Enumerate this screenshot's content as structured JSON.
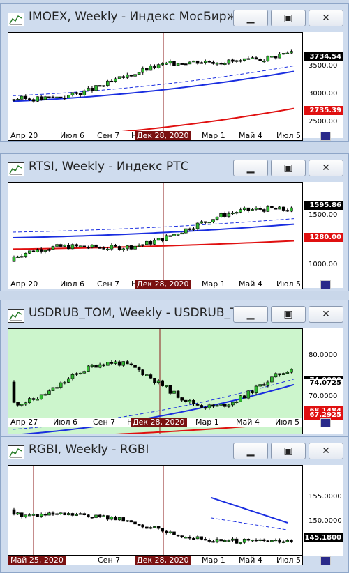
{
  "windows": [
    {
      "title": "IMOEX, Weekly - Индекс МосБиржи",
      "bg": "#ffffff",
      "y_ticks": [
        "3500.00",
        "3000.00",
        "2500.00"
      ],
      "last_price": "3734.54",
      "ma_price": "2735.39",
      "x_labels": [
        "Апр 20",
        "Июл 6",
        "Сен 7",
        "Н",
        "Мар 1",
        "Май 4",
        "Июл 5"
      ],
      "selected_date": "Дек 28, 2020",
      "chart": {
        "ymin": 2250,
        "ymax": 3950,
        "start": 2880,
        "end": 3734.54,
        "ma_fast_start": 2850,
        "ma_fast_end": 3330,
        "ma_slow_start": 2240,
        "ma_slow_end": 2735.39
      }
    },
    {
      "title": "RTSI, Weekly - Индекс РТС",
      "bg": "#ffffff",
      "y_ticks": [
        "1500.00",
        "1000.00"
      ],
      "last_price": "1595.86",
      "ma_price": "1280.00",
      "x_labels": [
        "Апр 20",
        "Июл 6",
        "Сен 7",
        "Н",
        "Мар 1",
        "Май 4",
        "Июл 5"
      ],
      "selected_date": "Дек 28, 2020",
      "chart": {
        "ymin": 820,
        "ymax": 1840,
        "start": 1080,
        "end": 1595.86,
        "ma_fast_start": 1310,
        "ma_fast_end": 1440,
        "ma_slow_start": 1200,
        "ma_slow_end": 1280
      }
    },
    {
      "title": "USDRUB_TOM, Weekly - USDRUB_T...",
      "bg": "#ccf5cc",
      "y_ticks": [
        "80.0000",
        "70.0000"
      ],
      "last_price": "74.0725",
      "hidden_price": "74.0000",
      "ma_price": "67.2925",
      "ma_price2": "68.1484",
      "x_labels": [
        "Апр 27",
        "Июл 6",
        "Сен 7",
        "Н",
        "Мар 1",
        "Май 4",
        "Июл 5"
      ],
      "selected_date": "Дек 28, 2020",
      "chart": {
        "ymin": 65,
        "ymax": 85,
        "start": 75,
        "end": 74.07,
        "ma_fast_start": 65,
        "ma_fast_end": 74.5,
        "ma_slow_start": 64.5,
        "ma_slow_end": 67.3
      }
    },
    {
      "title": "RGBI, Weekly - RGBI",
      "bg": "#ffffff",
      "y_ticks": [
        "155.0000",
        "150.0000"
      ],
      "last_price": "145.1800",
      "x_labels": [
        "Мар 1",
        "Май 4",
        "Июл 5"
      ],
      "selected_date": "Дек 28, 2020",
      "selected_date2": "Май 25, 2020",
      "other_labels": [
        "Сен 7"
      ],
      "chart": {
        "ymin": 143.5,
        "ymax": 160,
        "start": 152,
        "end": 145.18
      }
    }
  ]
}
